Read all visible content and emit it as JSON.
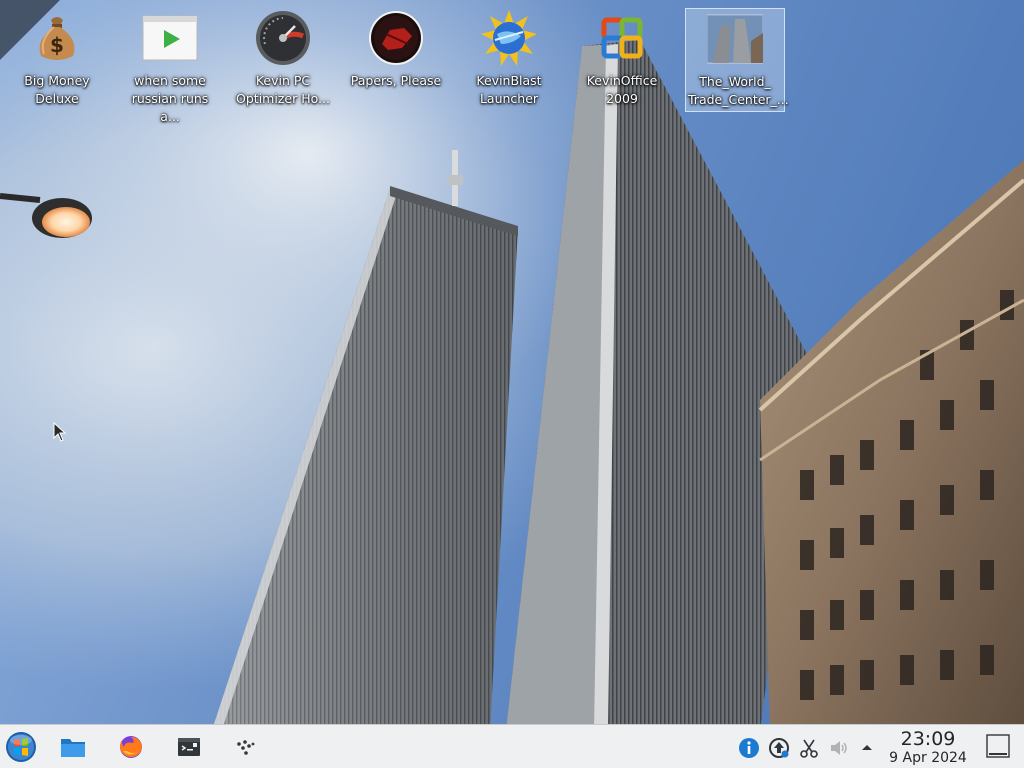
{
  "desktop": {
    "icons": [
      {
        "label": "Big Money\nDeluxe",
        "icon": "money-bag-icon"
      },
      {
        "label": "when some\nrussian runs a...",
        "icon": "video-file-icon"
      },
      {
        "label": "Kevin PC\nOptimizer Ho...",
        "icon": "speedometer-icon"
      },
      {
        "label": "Papers, Please",
        "icon": "papers-please-icon"
      },
      {
        "label": "KevinBlast\nLauncher",
        "icon": "kevinblast-globe-icon"
      },
      {
        "label": "KevinOffice\n2009",
        "icon": "office-logo-icon"
      },
      {
        "label": "The_World_\nTrade_Center_...",
        "icon": "image-thumbnail-icon",
        "selected": true
      }
    ]
  },
  "taskbar": {
    "launchers": [
      {
        "name": "start-menu-button",
        "icon": "start-orb-icon"
      },
      {
        "name": "file-manager-button",
        "icon": "folder-icon"
      },
      {
        "name": "firefox-button",
        "icon": "firefox-icon"
      },
      {
        "name": "terminal-button",
        "icon": "terminal-icon"
      },
      {
        "name": "dots-app-button",
        "icon": "dots-icon"
      }
    ],
    "tray": [
      {
        "icon": "info-icon"
      },
      {
        "icon": "updates-icon"
      },
      {
        "icon": "scissors-icon"
      },
      {
        "icon": "volume-icon"
      },
      {
        "icon": "tray-expand-icon"
      }
    ],
    "clock": {
      "time": "23:09",
      "date": "9 Apr 2024"
    }
  },
  "colors": {
    "sky": "#5f86c2",
    "taskbar": "#eff0f1",
    "label_text": "#ffffff"
  }
}
